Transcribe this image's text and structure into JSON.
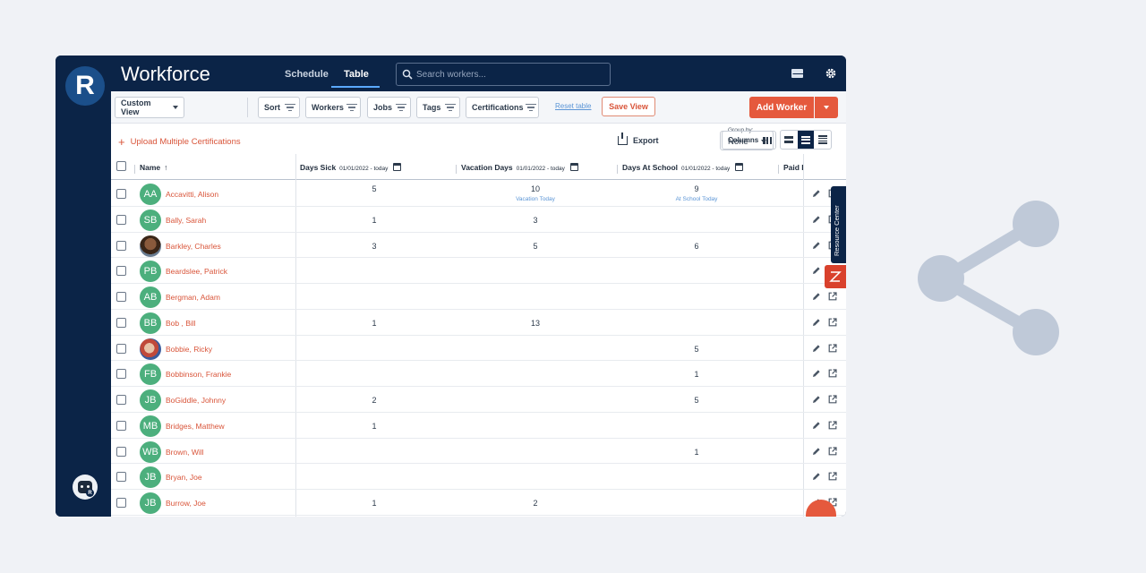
{
  "app": {
    "logo_letter": "R",
    "title": "Workforce",
    "tabs": [
      {
        "label": "Schedule"
      },
      {
        "label": "Table"
      }
    ],
    "search_placeholder": "Search workers...",
    "user_initials": "AA"
  },
  "toolbar": {
    "custom_view": "Custom View",
    "sort": "Sort",
    "workers": "Workers",
    "jobs": "Jobs",
    "tags": "Tags",
    "certifications": "Certifications",
    "reset_table": "Reset table",
    "save_view": "Save View",
    "add_worker": "Add Worker"
  },
  "subbar": {
    "upload": "Upload Multiple Certifications",
    "export": "Export",
    "group_by_label": "Group by:",
    "group_by_value": "None",
    "columns": "Columns"
  },
  "table": {
    "headers": {
      "name": "Name",
      "days_sick": "Days Sick",
      "days_sick_range": "01/01/2022 - today",
      "vacation_days": "Vacation Days",
      "vacation_days_range": "01/01/2022 - today",
      "days_at_school": "Days At School",
      "days_at_school_range": "01/01/2022 - today",
      "paid": "Paid I"
    },
    "rows": [
      {
        "initials": "AA",
        "name": "Accavitti, Alison",
        "sick": "5",
        "vacation": "10",
        "vacation_note": "Vacation Today",
        "school": "9",
        "school_note": "At School Today"
      },
      {
        "initials": "SB",
        "name": "Bally, Sarah",
        "sick": "1",
        "vacation": "3",
        "vacation_note": "",
        "school": "",
        "school_note": ""
      },
      {
        "initials": "",
        "name": "Barkley, Charles",
        "sick": "3",
        "vacation": "5",
        "vacation_note": "",
        "school": "6",
        "school_note": ""
      },
      {
        "initials": "PB",
        "name": "Beardslee, Patrick",
        "sick": "",
        "vacation": "",
        "vacation_note": "",
        "school": "",
        "school_note": ""
      },
      {
        "initials": "AB",
        "name": "Bergman, Adam",
        "sick": "",
        "vacation": "",
        "vacation_note": "",
        "school": "",
        "school_note": ""
      },
      {
        "initials": "BB",
        "name": "Bob , Bill",
        "sick": "1",
        "vacation": "13",
        "vacation_note": "",
        "school": "",
        "school_note": ""
      },
      {
        "initials": "",
        "name": "Bobbie, Ricky",
        "sick": "",
        "vacation": "",
        "vacation_note": "",
        "school": "5",
        "school_note": ""
      },
      {
        "initials": "FB",
        "name": "Bobbinson, Frankie",
        "sick": "",
        "vacation": "",
        "vacation_note": "",
        "school": "1",
        "school_note": ""
      },
      {
        "initials": "JB",
        "name": "BoGiddle, Johnny",
        "sick": "2",
        "vacation": "",
        "vacation_note": "",
        "school": "5",
        "school_note": ""
      },
      {
        "initials": "MB",
        "name": "Bridges, Matthew",
        "sick": "1",
        "vacation": "",
        "vacation_note": "",
        "school": "",
        "school_note": ""
      },
      {
        "initials": "WB",
        "name": "Brown, Will",
        "sick": "",
        "vacation": "",
        "vacation_note": "",
        "school": "1",
        "school_note": ""
      },
      {
        "initials": "JB",
        "name": "Bryan, Joe",
        "sick": "",
        "vacation": "",
        "vacation_note": "",
        "school": "",
        "school_note": ""
      },
      {
        "initials": "JB",
        "name": "Burrow, Joe",
        "sick": "1",
        "vacation": "2",
        "vacation_note": "",
        "school": "",
        "school_note": ""
      }
    ]
  },
  "resource_center": "Resource Center",
  "icons": [
    "search-icon",
    "mail-icon",
    "gear-icon",
    "filter-icon",
    "download-icon",
    "columns-icon",
    "calendar-icon",
    "edit-icon",
    "open-in-new-icon",
    "share-icon",
    "bolt-icon"
  ],
  "colors": {
    "navy": "#0b2447",
    "accent": "#e5593d",
    "avatar_green": "#4caf7d",
    "link_blue": "#5b95d6"
  }
}
